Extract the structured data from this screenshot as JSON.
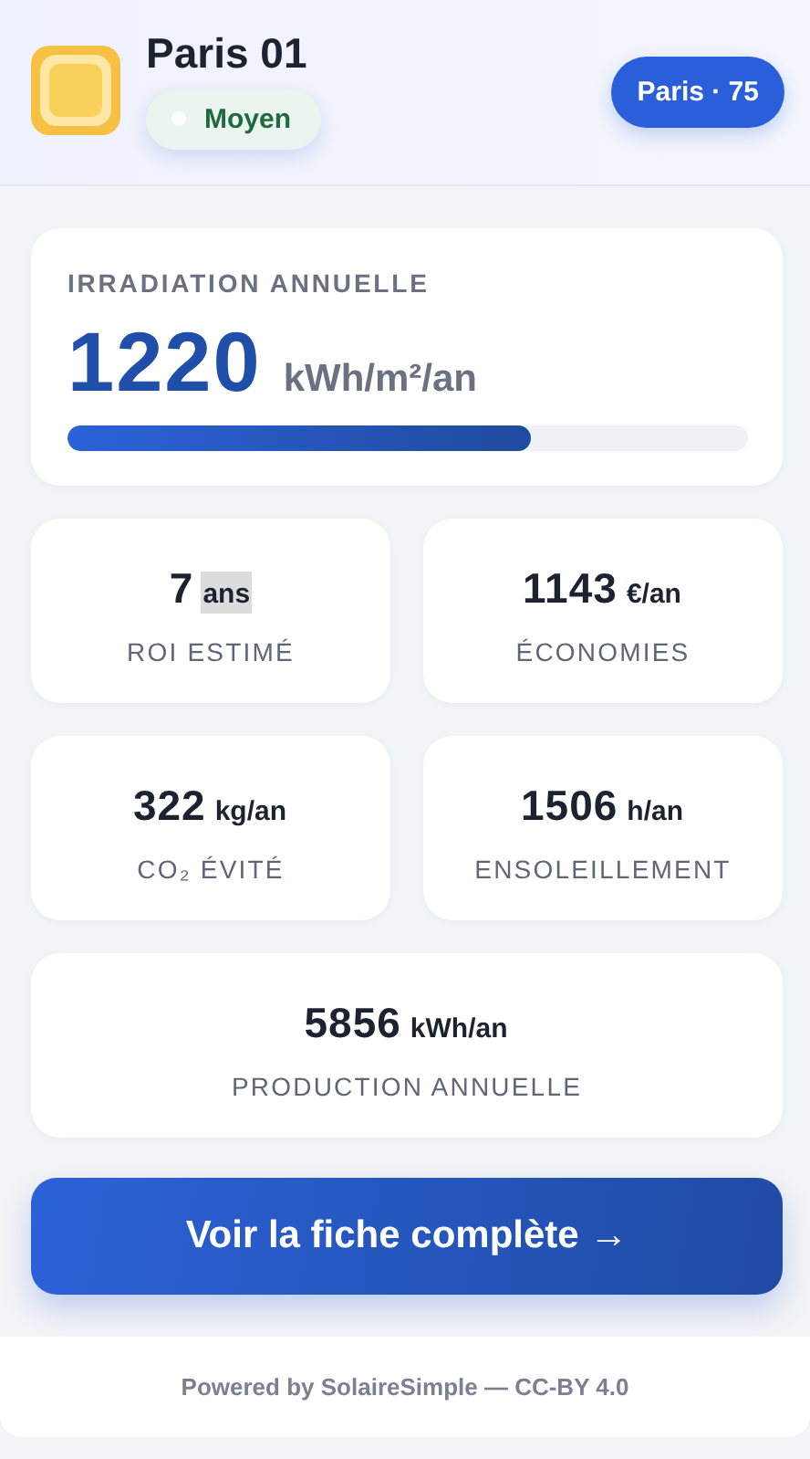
{
  "header": {
    "title": "Paris 01",
    "status": {
      "label": "Moyen"
    },
    "location_badge": "Paris · 75"
  },
  "irradiation": {
    "label": "IRRADIATION ANNUELLE",
    "value": "1220",
    "unit": "kWh/m²/an",
    "level": 0.68
  },
  "stats": [
    {
      "value": "7",
      "unit": "ans",
      "unit_highlighted": true,
      "label": "ROI ESTIMÉ",
      "wide": false
    },
    {
      "value": "1143",
      "unit": "€/an",
      "unit_highlighted": false,
      "label": "ÉCONOMIES",
      "wide": false
    },
    {
      "value": "322",
      "unit": "kg/an",
      "unit_highlighted": false,
      "label": "CO₂ ÉVITÉ",
      "wide": false
    },
    {
      "value": "1506",
      "unit": "h/an",
      "unit_highlighted": false,
      "label": "ENSOLEILLEMENT",
      "wide": false
    },
    {
      "value": "5856",
      "unit": "kWh/an",
      "unit_highlighted": false,
      "label": "PRODUCTION ANNUELLE",
      "wide": true
    }
  ],
  "cta_button": "Voir la fiche complète →",
  "footer": "Powered by SolaireSimple — CC-BY 4.0"
}
